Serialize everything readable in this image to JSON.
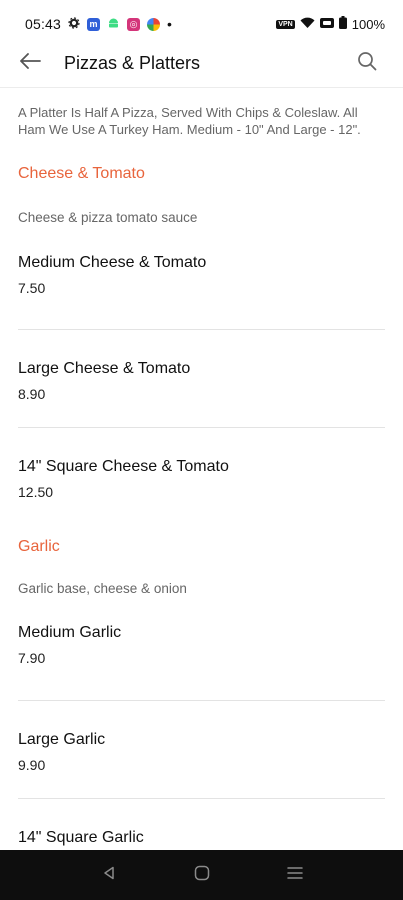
{
  "status_bar": {
    "time": "05:43",
    "vpn_label": "VPN",
    "battery": "100%"
  },
  "header": {
    "title": "Pizzas & Platters"
  },
  "intro": "A Platter Is Half A Pizza, Served With Chips & Coleslaw. All Ham We Use A Turkey Ham. Medium - 10\" And Large - 12\".",
  "sections": [
    {
      "title": "Cheese & Tomato",
      "description": "Cheese & pizza tomato sauce",
      "items": [
        {
          "name": "Medium Cheese & Tomato",
          "price": "7.50"
        },
        {
          "name": "Large Cheese & Tomato",
          "price": "8.90"
        },
        {
          "name": "14\" Square Cheese & Tomato",
          "price": "12.50"
        }
      ]
    },
    {
      "title": "Garlic",
      "description": "Garlic base, cheese & onion",
      "items": [
        {
          "name": "Medium Garlic",
          "price": "7.90"
        },
        {
          "name": "Large Garlic",
          "price": "9.90"
        },
        {
          "name": "14\" Square Garlic",
          "price": ""
        }
      ]
    }
  ],
  "colors": {
    "accent": "#e8643c",
    "nav_bar": "#0e0e0e"
  }
}
